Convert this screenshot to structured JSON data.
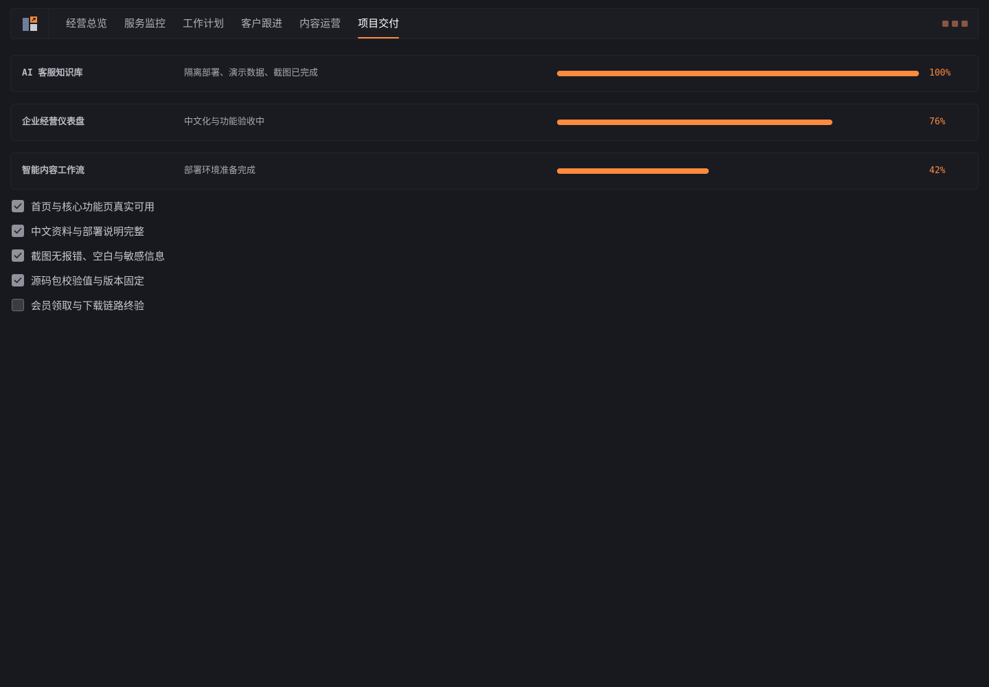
{
  "nav": {
    "tabs": [
      {
        "label": "经营总览"
      },
      {
        "label": "服务监控"
      },
      {
        "label": "工作计划"
      },
      {
        "label": "客户跟进"
      },
      {
        "label": "内容运营"
      },
      {
        "label": "项目交付"
      }
    ],
    "active_tab": 5,
    "window_controls": [
      "more-icon",
      "more-icon",
      "more-icon"
    ]
  },
  "projects": [
    {
      "name": "AI 客服知识库",
      "desc": "隔离部署、演示数据、截图已完成",
      "progress": 100,
      "progress_label": "100%"
    },
    {
      "name": "企业经营仪表盘",
      "desc": "中文化与功能验收中",
      "progress": 76,
      "progress_label": "76%"
    },
    {
      "name": "智能内容工作流",
      "desc": "部署环境准备完成",
      "progress": 42,
      "progress_label": "42%"
    }
  ],
  "checklist": [
    {
      "label": "首页与核心功能页真实可用",
      "checked": true
    },
    {
      "label": "中文资料与部署说明完整",
      "checked": true
    },
    {
      "label": "截图无报错、空白与敏感信息",
      "checked": true
    },
    {
      "label": "源码包校验值与版本固定",
      "checked": true
    },
    {
      "label": "会员领取与下载链路终验",
      "checked": false
    }
  ],
  "colors": {
    "accent": "#ff8a3d",
    "background": "#18191e"
  }
}
